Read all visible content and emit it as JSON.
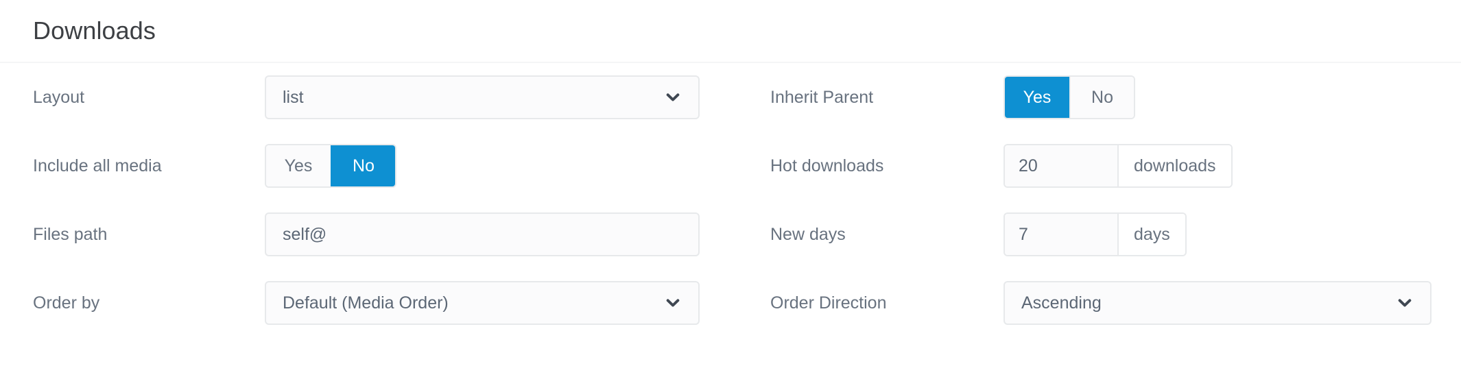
{
  "panel": {
    "title": "Downloads"
  },
  "theme": {
    "accent": "#0e90d2",
    "label_color": "#68727f",
    "value_color": "#5c6775",
    "border_color": "#e7e9eb",
    "control_bg": "#fbfbfc",
    "title_color": "#3d4044",
    "divider": "#f4f5f6"
  },
  "fields": {
    "layout": {
      "label": "Layout",
      "value": "list",
      "icon": "chevron-down-icon"
    },
    "inherit_parent": {
      "label": "Inherit Parent",
      "options": [
        "Yes",
        "No"
      ],
      "selected": "Yes"
    },
    "include_all_media": {
      "label": "Include all media",
      "options": [
        "Yes",
        "No"
      ],
      "selected": "No"
    },
    "hot_downloads": {
      "label": "Hot downloads",
      "value": "20",
      "suffix": "downloads"
    },
    "files_path": {
      "label": "Files path",
      "value": "self@",
      "placeholder": ""
    },
    "new_days": {
      "label": "New days",
      "value": "7",
      "suffix": "days"
    },
    "order_by": {
      "label": "Order by",
      "value": "Default (Media Order)",
      "icon": "chevron-down-icon"
    },
    "order_direction": {
      "label": "Order Direction",
      "value": "Ascending",
      "icon": "chevron-down-icon"
    }
  }
}
